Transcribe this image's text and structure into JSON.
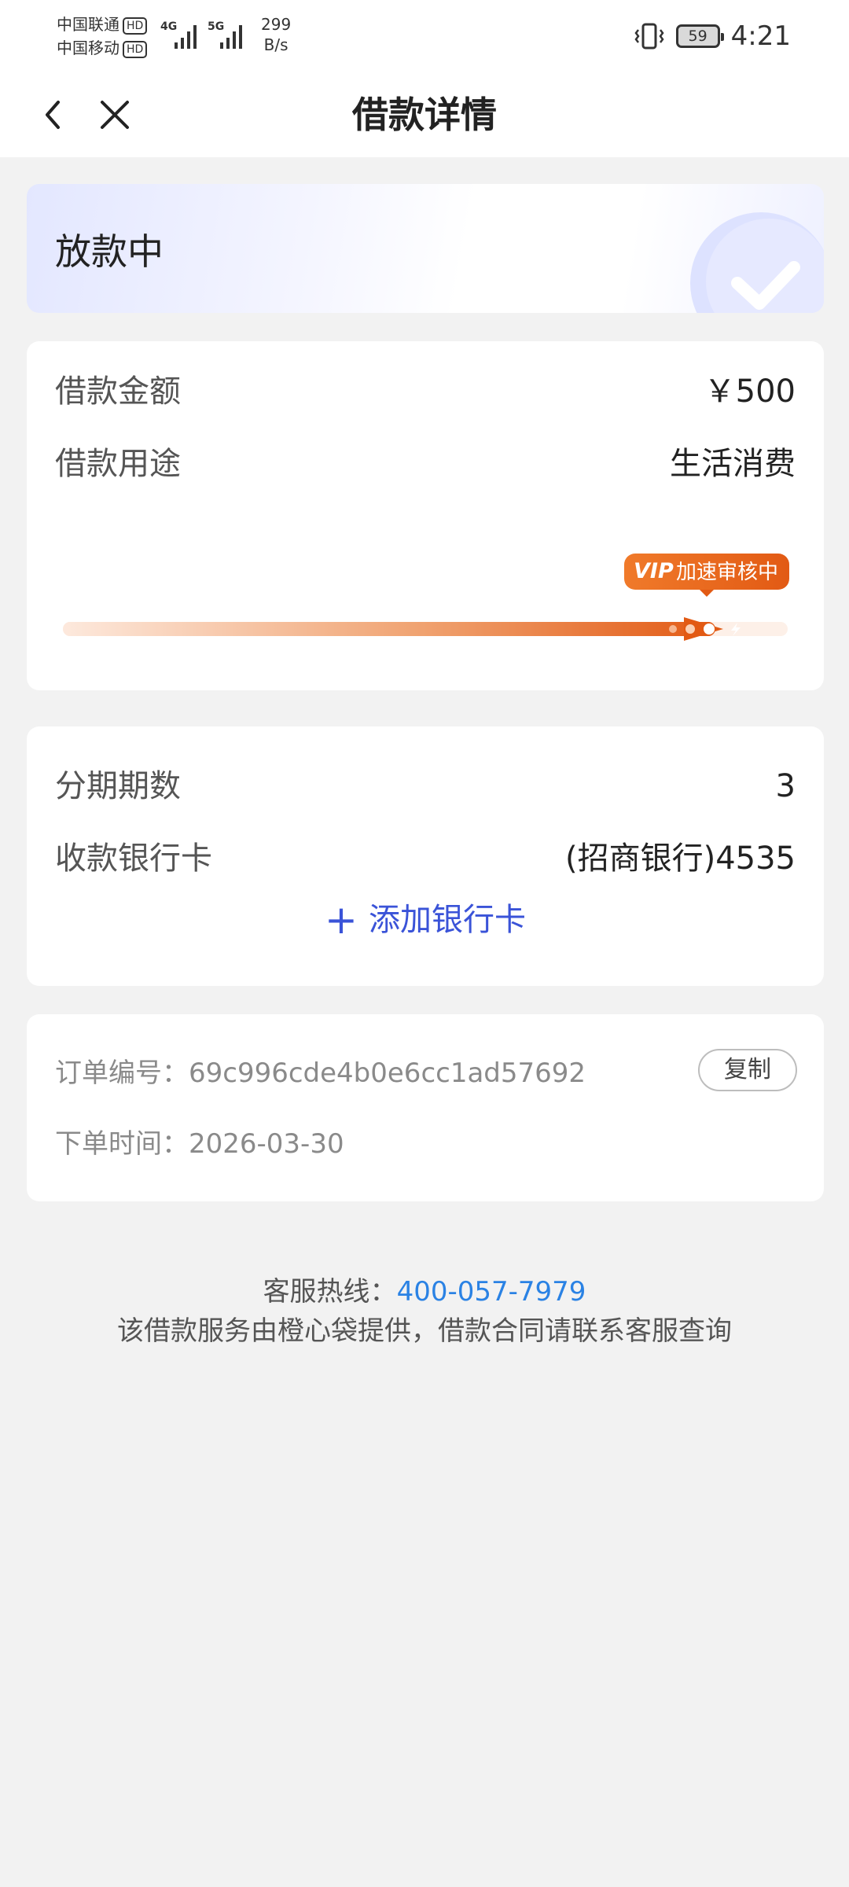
{
  "status_bar": {
    "carrier1": "中国联通",
    "carrier2": "中国移动",
    "hd": "HD",
    "net1": "4G",
    "net2": "5G",
    "speed_value": "299",
    "speed_unit": "B/s",
    "battery": "59",
    "time": "4:21"
  },
  "header": {
    "title": "借款详情",
    "back_icon": "chevron-left-icon",
    "close_icon": "close-icon"
  },
  "status_card": {
    "status": "放款中",
    "icon": "check-circle-icon"
  },
  "loan": {
    "amount_label": "借款金额",
    "amount_value": "￥500",
    "purpose_label": "借款用途",
    "purpose_value": "生活消费",
    "vip_badge": "加速审核中",
    "vip_mark": "VIP",
    "progress_color": "#e8601c"
  },
  "installment": {
    "periods_label": "分期期数",
    "periods_value": "3",
    "bank_label": "收款银行卡",
    "bank_value": "(招商银行)4535",
    "add_card_label": "添加银行卡"
  },
  "order": {
    "id_label": "订单编号：",
    "id_value": "69c996cde4b0e6cc1ad57692",
    "copy_label": "复制",
    "time_label": "下单时间：",
    "time_value": "2026-03-30"
  },
  "footer": {
    "hotline_label": "客服热线：",
    "hotline_number": "400-057-7979",
    "notice": "该借款服务由橙心袋提供，借款合同请联系客服查询"
  },
  "colors": {
    "accent_blue": "#3a53d8",
    "link_blue": "#2a82e4",
    "orange": "#e8601c"
  }
}
